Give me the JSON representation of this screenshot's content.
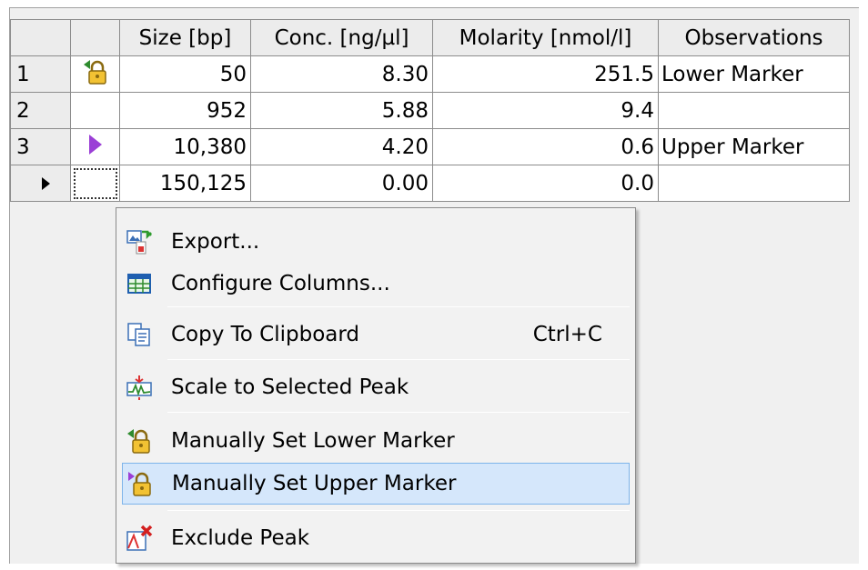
{
  "table": {
    "headers": [
      "",
      "",
      "Size [bp]",
      "Conc. [ng/µl]",
      "Molarity [nmol/l]",
      "Observations"
    ],
    "rows": [
      {
        "index": "1",
        "size": "50",
        "conc": "8.30",
        "molarity": "251.5",
        "obs": "Lower Marker",
        "icon": "lower-marker-lock-icon"
      },
      {
        "index": "2",
        "size": "952",
        "conc": "5.88",
        "molarity": "9.4",
        "obs": "",
        "icon": ""
      },
      {
        "index": "3",
        "size": "10,380",
        "conc": "4.20",
        "molarity": "0.6",
        "obs": "Upper Marker",
        "icon": "upper-marker-triangle-icon"
      },
      {
        "index": "",
        "size": "150,125",
        "conc": "0.00",
        "molarity": "0.0",
        "obs": "",
        "icon": ""
      }
    ]
  },
  "menu": {
    "items": [
      {
        "label": "Export...",
        "shortcut": "",
        "icon": "export-icon"
      },
      {
        "label": "Configure Columns...",
        "shortcut": "",
        "icon": "configure-columns-icon"
      },
      {
        "label": "Copy To Clipboard",
        "shortcut": "Ctrl+C",
        "icon": "copy-icon"
      },
      {
        "label": "Scale to Selected Peak",
        "shortcut": "",
        "icon": "scale-peak-icon"
      },
      {
        "label": "Manually Set Lower Marker",
        "shortcut": "",
        "icon": "lower-marker-lock-icon"
      },
      {
        "label": "Manually Set Upper Marker",
        "shortcut": "",
        "icon": "upper-marker-lock-icon"
      },
      {
        "label": "Exclude Peak",
        "shortcut": "",
        "icon": "exclude-peak-icon"
      }
    ]
  },
  "colors": {
    "upper_marker": "#9b3fd6",
    "lower_marker": "#2e8b2e",
    "highlight": "#d5e7fb"
  }
}
